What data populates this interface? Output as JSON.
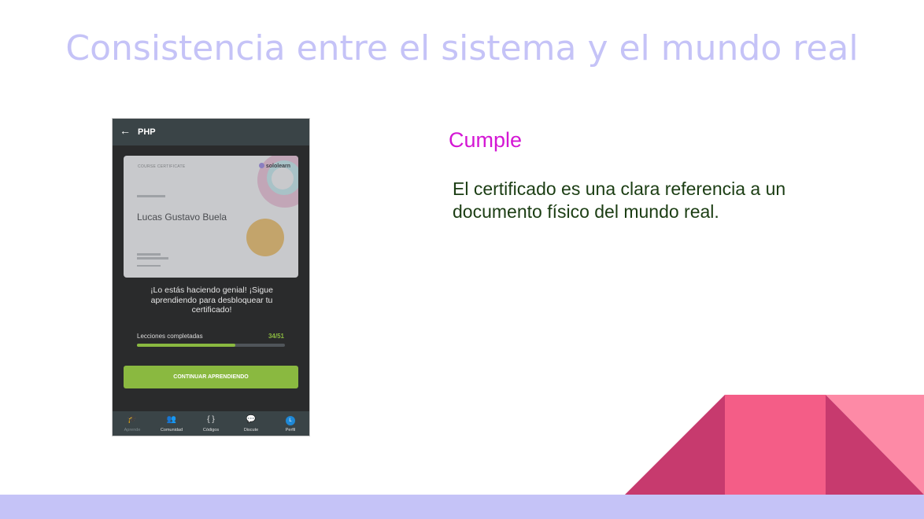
{
  "slide": {
    "title": "Consistencia entre el sistema y el mundo real",
    "verdict": "Cumple",
    "explanation": "El certificado es una clara referencia a un documento físico del mundo real."
  },
  "phone": {
    "appbar": {
      "back_icon": "arrow-left-icon",
      "title": "PHP"
    },
    "certificate": {
      "label": "COURSE CERTIFICATE",
      "brand": "sololearn",
      "holder_name": "Lucas Gustavo Buela"
    },
    "message": "¡Lo estás haciendo genial! ¡Sigue aprendiendo para desbloquear tu certificado!",
    "progress": {
      "label": "Lecciones completadas",
      "count": "34/51",
      "fraction": 0.667
    },
    "cta_label": "CONTINUAR APRENDIENDO",
    "nav": [
      {
        "label": "Aprende",
        "icon": "graduation-cap-icon",
        "glyph": "🎓",
        "active": true
      },
      {
        "label": "Comunidad",
        "icon": "people-icon",
        "glyph": "👥",
        "active": false
      },
      {
        "label": "Códigos",
        "icon": "code-braces-icon",
        "glyph": "{ }",
        "active": false
      },
      {
        "label": "Discute",
        "icon": "chat-bubbles-icon",
        "glyph": "💬",
        "active": false
      },
      {
        "label": "Perfil",
        "icon": "avatar-icon",
        "glyph": "L",
        "active": false
      }
    ]
  },
  "colors": {
    "title": "#c5c3f7",
    "verdict": "#d417d4",
    "explanation": "#1b3d13",
    "accent_green": "#8ab940",
    "deco_dark_pink": "#c73a6e",
    "deco_pink": "#f45d87",
    "deco_light_pink": "#fd8aa6",
    "band": "#c5c3f7"
  }
}
